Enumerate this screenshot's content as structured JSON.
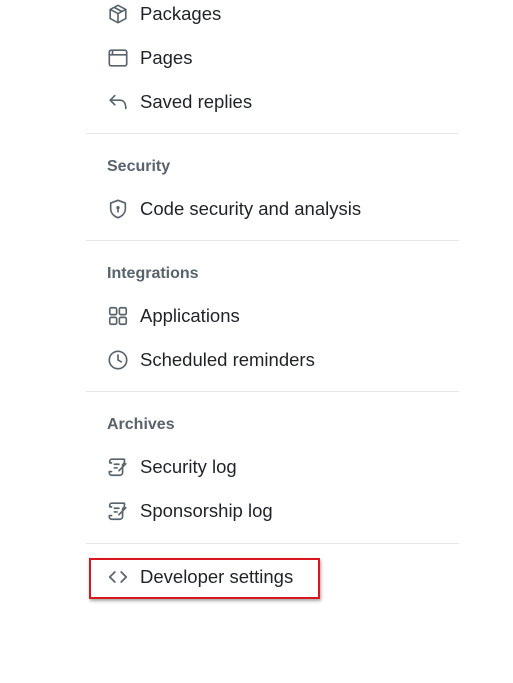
{
  "menu": {
    "packages_label": "Packages",
    "pages_label": "Pages",
    "saved_replies_label": "Saved replies",
    "security_heading": "Security",
    "code_security_label": "Code security and analysis",
    "integrations_heading": "Integrations",
    "applications_label": "Applications",
    "scheduled_reminders_label": "Scheduled reminders",
    "archives_heading": "Archives",
    "security_log_label": "Security log",
    "sponsorship_log_label": "Sponsorship log",
    "developer_settings_label": "Developer settings"
  },
  "icons": {
    "packages": "package-icon",
    "pages": "browser-icon",
    "saved_replies": "reply-icon",
    "code_security": "shield-lock-icon",
    "applications": "apps-icon",
    "scheduled_reminders": "clock-icon",
    "security_log": "log-icon",
    "sponsorship_log": "log-icon",
    "developer_settings": "code-icon"
  },
  "colors": {
    "text": "#1f2328",
    "heading": "#59636e",
    "icon": "#59636e",
    "divider": "#e6e8eb",
    "highlight_border": "#d9161d"
  }
}
